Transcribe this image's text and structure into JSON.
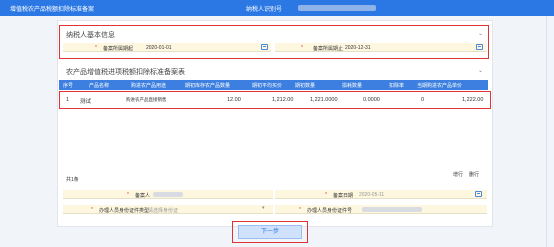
{
  "header": {
    "title": "增值税农产品税额扣除标准备案",
    "taxpayer_id_label": "纳税人识别号"
  },
  "basic_info": {
    "title": "纳税人基本信息",
    "period_start_label": "备案所属期起",
    "period_start_value": "2020-01-01",
    "period_end_label": "备案所属期止",
    "period_end_value": "2020-12-31"
  },
  "table": {
    "title": "农产品增值税进项税额扣除标准备案表",
    "columns": [
      "序号",
      "产品名称",
      "购进农产品用途",
      "期初库存农产品数量",
      "期初平均买价",
      "期初数量",
      "损耗数量",
      "扣除率",
      "当期购进农产品单价"
    ],
    "rows": [
      {
        "index": "1",
        "product_name": "测试",
        "purpose": "购进农产品直接销售",
        "opening_stock_qty": "12.00",
        "avg_price": "1,212.00",
        "opening_qty": "1,221.0000",
        "loss_qty": "0.0000",
        "deduction_rate": "0",
        "unit_price": "1,222.00"
      }
    ],
    "total_label": "共1条",
    "add_label": "增行",
    "delete_label": "删行"
  },
  "footer": {
    "filer_label": "备案人",
    "filing_date_label": "备案日期",
    "filing_date_value": "2020-05-11",
    "agent_id_type_label": "办理人员身份证件类型",
    "agent_id_type_placeholder": "请选择身份证",
    "agent_id_no_label": "办理人员身份证件号"
  },
  "actions": {
    "next_label": "下一步"
  }
}
